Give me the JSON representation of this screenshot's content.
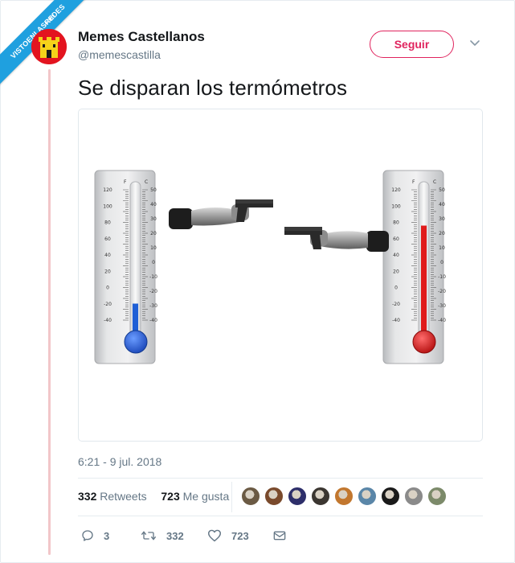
{
  "watermark": {
    "text": "VISTOENLASREDES",
    "subtext": ".com",
    "color": "#1fa0df"
  },
  "author": {
    "name": "Memes Castellanos",
    "handle": "@memescastilla",
    "avatar_icon": "castle-avatar",
    "avatar_color": "#e3141f"
  },
  "follow_button": {
    "label": "Seguir",
    "color": "#e0245e"
  },
  "tweet": {
    "text": "Se disparan los termómetros",
    "timestamp": "6:21 - 9 jul. 2018"
  },
  "image": {
    "description_icons": [
      "thermometer-cold",
      "pistol-arm",
      "pistol-arm",
      "thermometer-hot"
    ],
    "scale_f": [
      "120",
      "100",
      "80",
      "60",
      "40",
      "20",
      "0",
      "-20",
      "-40"
    ],
    "scale_c": [
      "50",
      "40",
      "30",
      "20",
      "10",
      "0",
      "-10",
      "-20",
      "-30",
      "-40"
    ],
    "thermometer_left": {
      "level": 0.25,
      "color": "#1f5fd6"
    },
    "thermometer_right": {
      "level": 0.75,
      "color": "#e01b1b"
    }
  },
  "stats": {
    "retweets_count": "332",
    "retweets_label": "Retweets",
    "likes_count": "723",
    "likes_label": "Me gusta",
    "likers": [
      "#6b5a44",
      "#7a4a2c",
      "#2d2e6a",
      "#3b3631",
      "#c2772e",
      "#5a86a8",
      "#1a1a1a",
      "#8a8a8a",
      "#7c8a6a"
    ]
  },
  "actions": {
    "reply_count": "3",
    "retweet_count": "332",
    "like_count": "723"
  }
}
